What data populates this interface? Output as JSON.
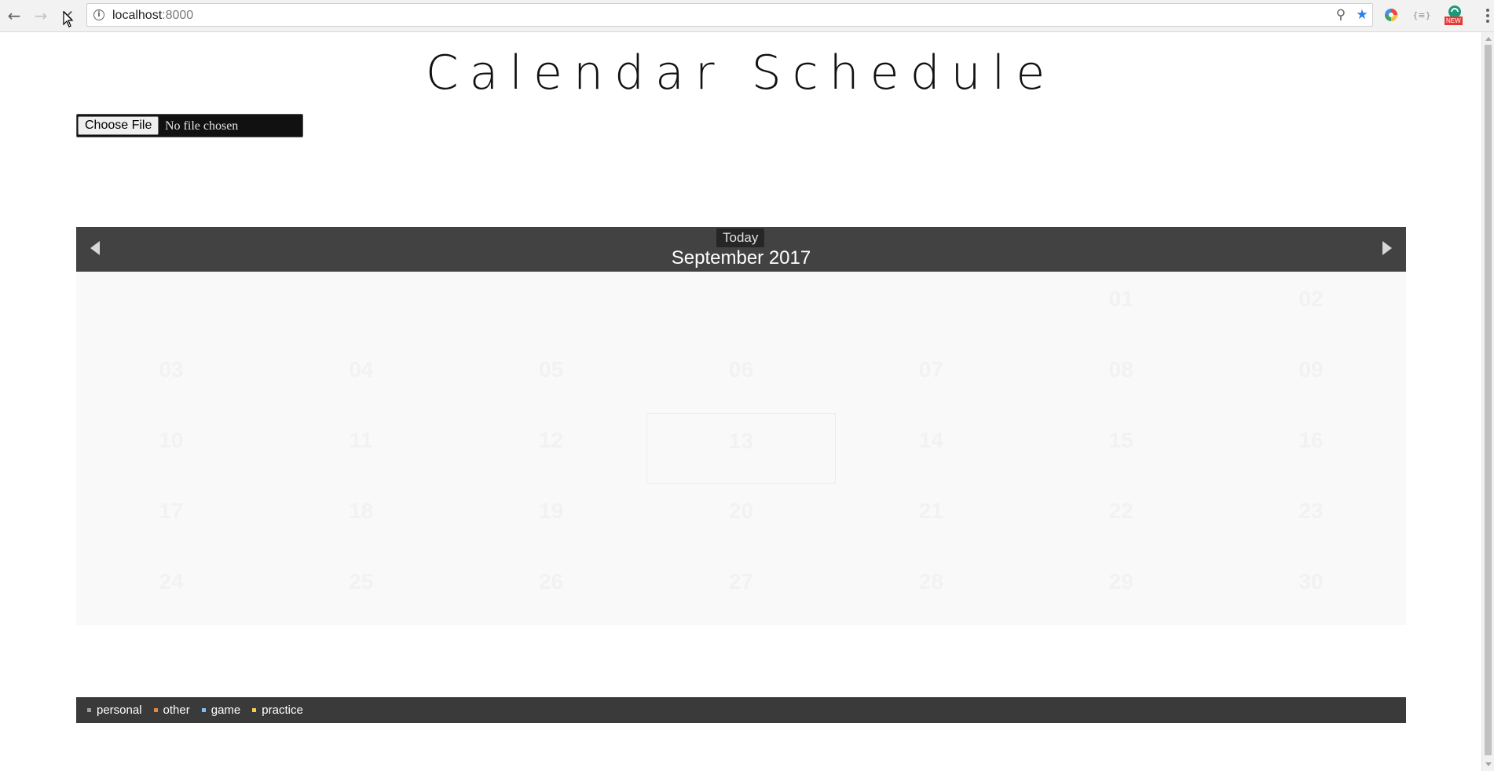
{
  "browser": {
    "url_host": "localhost",
    "url_port": ":8000",
    "back_icon": "←",
    "forward_icon": "→",
    "stop_icon": "✕",
    "info_icon": "i",
    "zoom_icon": "⚲",
    "star_icon": "★",
    "ext_json_label": "{≡}",
    "ext_new_badge": "NEW"
  },
  "page": {
    "title": "Calendar Schedule"
  },
  "file_input": {
    "button_label": "Choose File",
    "status": "No file chosen"
  },
  "calendar": {
    "today_label": "Today",
    "month_label": "September 2017",
    "weeks": [
      [
        {
          "d": "",
          "other": true
        },
        {
          "d": "",
          "other": true
        },
        {
          "d": "",
          "other": true
        },
        {
          "d": "",
          "other": true
        },
        {
          "d": "",
          "other": true
        },
        {
          "d": "01"
        },
        {
          "d": "02"
        }
      ],
      [
        {
          "d": "03"
        },
        {
          "d": "04"
        },
        {
          "d": "05"
        },
        {
          "d": "06"
        },
        {
          "d": "07"
        },
        {
          "d": "08"
        },
        {
          "d": "09"
        }
      ],
      [
        {
          "d": "10"
        },
        {
          "d": "11"
        },
        {
          "d": "12"
        },
        {
          "d": "13",
          "today": true
        },
        {
          "d": "14"
        },
        {
          "d": "15"
        },
        {
          "d": "16"
        }
      ],
      [
        {
          "d": "17"
        },
        {
          "d": "18"
        },
        {
          "d": "19"
        },
        {
          "d": "20"
        },
        {
          "d": "21"
        },
        {
          "d": "22"
        },
        {
          "d": "23"
        }
      ],
      [
        {
          "d": "24"
        },
        {
          "d": "25"
        },
        {
          "d": "26"
        },
        {
          "d": "27"
        },
        {
          "d": "28"
        },
        {
          "d": "29"
        },
        {
          "d": "30"
        }
      ]
    ]
  },
  "legend": [
    {
      "label": "personal",
      "color": "#9e9e9e"
    },
    {
      "label": "other",
      "color": "#e8883a"
    },
    {
      "label": "game",
      "color": "#7fbfff"
    },
    {
      "label": "practice",
      "color": "#f5cf4b"
    }
  ]
}
